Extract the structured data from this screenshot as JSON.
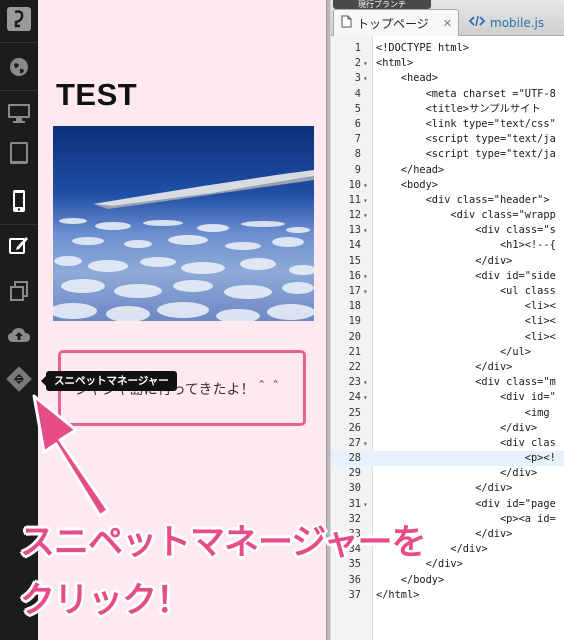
{
  "toolbar": {
    "items": [
      {
        "name": "logo-icon"
      },
      {
        "name": "globe-icon"
      },
      {
        "name": "desktop-icon"
      },
      {
        "name": "tablet-icon"
      },
      {
        "name": "smartphone-icon"
      },
      {
        "name": "edit-icon"
      },
      {
        "name": "pages-icon"
      },
      {
        "name": "cloud-upload-icon"
      },
      {
        "name": "snippet-manager-icon"
      }
    ],
    "tooltip": "スニペットマネージャー"
  },
  "preview": {
    "title": "TEST",
    "box_text": "ジャジャ島に行ってきたよ！＾＾",
    "accent_color": "#e8628d",
    "background_color": "#fde9ef"
  },
  "editor": {
    "branch_label": "現行ブランチ",
    "tabs": [
      {
        "label": "トップページ",
        "icon": "file-icon",
        "close": "✕"
      },
      {
        "label": "mobile.js",
        "icon": "code-icon"
      }
    ],
    "highlighted_line": 28,
    "lines": [
      {
        "n": "1",
        "fold": "",
        "text": "<!DOCTYPE html>"
      },
      {
        "n": "2",
        "fold": "▾",
        "text": "<html>"
      },
      {
        "n": "3",
        "fold": "▾",
        "text": "    <head>"
      },
      {
        "n": "4",
        "fold": "",
        "text": "        <meta charset =\"UTF-8"
      },
      {
        "n": "5",
        "fold": "",
        "text": "        <title>サンプルサイト"
      },
      {
        "n": "6",
        "fold": "",
        "text": "        <link type=\"text/css\""
      },
      {
        "n": "7",
        "fold": "",
        "text": "        <script type=\"text/ja"
      },
      {
        "n": "8",
        "fold": "",
        "text": "        <script type=\"text/ja"
      },
      {
        "n": "9",
        "fold": "",
        "text": "    </head>"
      },
      {
        "n": "10",
        "fold": "▾",
        "text": "    <body>"
      },
      {
        "n": "11",
        "fold": "▾",
        "text": "        <div class=\"header\">"
      },
      {
        "n": "12",
        "fold": "▾",
        "text": "            <div class=\"wrapp"
      },
      {
        "n": "13",
        "fold": "▾",
        "text": "                <div class=\"s"
      },
      {
        "n": "14",
        "fold": "",
        "text": "                    <h1><!--{"
      },
      {
        "n": "15",
        "fold": "",
        "text": "                </div>"
      },
      {
        "n": "16",
        "fold": "▾",
        "text": "                <div id=\"side"
      },
      {
        "n": "17",
        "fold": "▾",
        "text": "                    <ul class"
      },
      {
        "n": "18",
        "fold": "",
        "text": "                        <li><"
      },
      {
        "n": "19",
        "fold": "",
        "text": "                        <li><"
      },
      {
        "n": "20",
        "fold": "",
        "text": "                        <li><"
      },
      {
        "n": "21",
        "fold": "",
        "text": "                    </ul>"
      },
      {
        "n": "22",
        "fold": "",
        "text": "                </div>"
      },
      {
        "n": "23",
        "fold": "▾",
        "text": "                <div class=\"m"
      },
      {
        "n": "24",
        "fold": "▾",
        "text": "                    <div id=\""
      },
      {
        "n": "25",
        "fold": "",
        "text": "                        <img"
      },
      {
        "n": "26",
        "fold": "",
        "text": "                    </div>"
      },
      {
        "n": "27",
        "fold": "▾",
        "text": "                    <div clas"
      },
      {
        "n": "28",
        "fold": "",
        "text": "                        <p><!"
      },
      {
        "n": "29",
        "fold": "",
        "text": "                    </div>"
      },
      {
        "n": "30",
        "fold": "",
        "text": "                </div>"
      },
      {
        "n": "31",
        "fold": "▾",
        "text": "                <div id=\"page"
      },
      {
        "n": "32",
        "fold": "",
        "text": "                    <p><a id="
      },
      {
        "n": "33",
        "fold": "",
        "text": "                </div>"
      },
      {
        "n": "34",
        "fold": "",
        "text": "            </div>"
      },
      {
        "n": "35",
        "fold": "",
        "text": "        </div>"
      },
      {
        "n": "36",
        "fold": "",
        "text": "    </body>"
      },
      {
        "n": "37",
        "fold": "",
        "text": "</html>"
      }
    ]
  },
  "annotation": {
    "line1": "スニペットマネージャーを",
    "line2": "クリック！",
    "color": "#e64d86"
  }
}
